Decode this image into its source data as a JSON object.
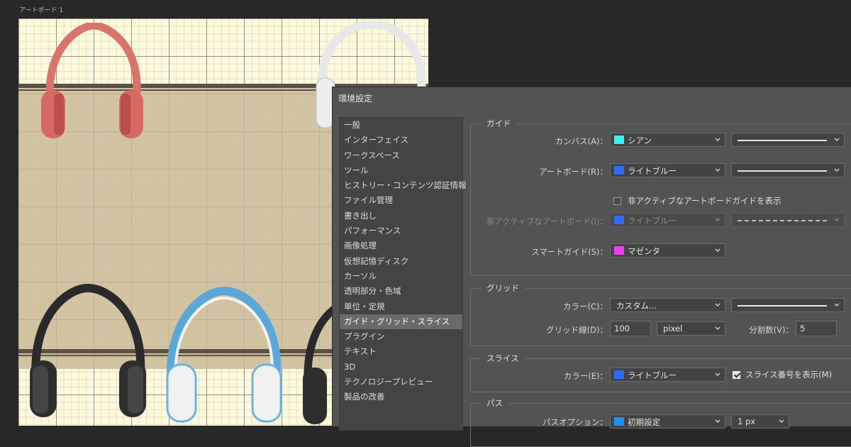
{
  "artboard": {
    "label": "アートボード 1"
  },
  "dialog": {
    "title": "環境設定",
    "nav": [
      "一般",
      "インターフェイス",
      "ワークスペース",
      "ツール",
      "ヒストリー・コンテンツ認証情報",
      "ファイル管理",
      "書き出し",
      "パフォーマンス",
      "画像処理",
      "仮想記憶ディスク",
      "カーソル",
      "透明部分・色域",
      "単位・定規",
      "ガイド・グリッド・スライス",
      "プラグイン",
      "テキスト",
      "3D",
      "テクノロジープレビュー",
      "製品の改善"
    ],
    "selected_nav": "ガイド・グリッド・スライス",
    "guides": {
      "title": "ガイド",
      "canvas_label": "カンバス(A)：",
      "canvas_color": "シアン",
      "canvas_swatch": "#3ef0f0",
      "artboard_label": "アートボード(R)：",
      "artboard_color": "ライトブルー",
      "artboard_swatch": "#2f6bff",
      "inactive_checkbox_label": "非アクティブなアートボードガイドを表示",
      "inactive_label": "非アクティブなアートボード(I)：",
      "inactive_color": "ライトブルー",
      "inactive_swatch": "#2f6bff",
      "smart_label": "スマートガイド(S)：",
      "smart_color": "マゼンタ",
      "smart_swatch": "#f03cf0"
    },
    "grid": {
      "title": "グリッド",
      "color_label": "カラー(C)：",
      "color_value": "カスタム...",
      "gridline_label": "グリッド線(D)：",
      "gridline_value": "100",
      "gridline_unit": "pixel",
      "subdiv_label": "分割数(V)：",
      "subdiv_value": "5"
    },
    "slice": {
      "title": "スライス",
      "color_label": "カラー(E)：",
      "color_value": "ライトブルー",
      "color_swatch": "#2f6bff",
      "show_number_label": "スライス番号を表示(M)",
      "show_number_checked": true
    },
    "path": {
      "title": "パス",
      "options_label": "パスオプション：",
      "options_value": "初期設定",
      "options_swatch": "#1e90ff",
      "width_value": "1 px"
    }
  }
}
